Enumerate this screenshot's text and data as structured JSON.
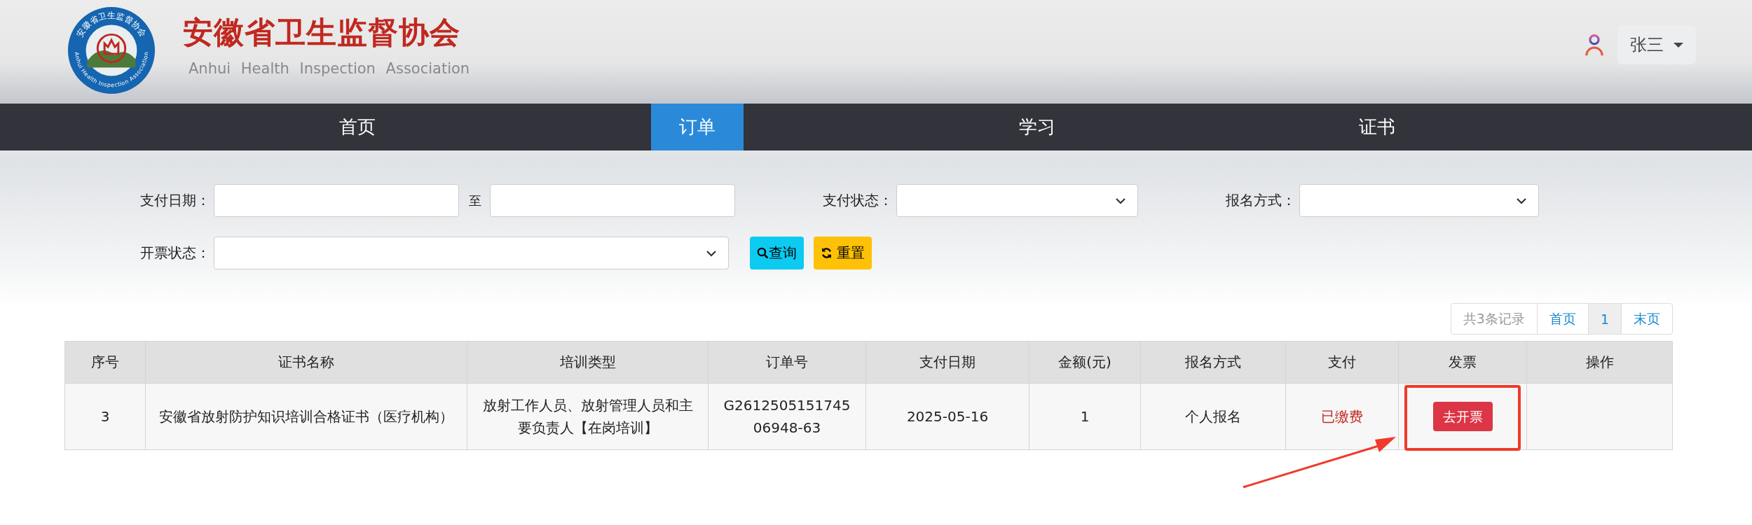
{
  "header": {
    "logo": {
      "ring_top": "安徽省卫生监督协会",
      "ring_bottom": "Anhui Health Inspection Association"
    },
    "title": "安徽省卫生监督协会",
    "subtitle": "Anhui Health Inspection Association",
    "user": "张三"
  },
  "nav": [
    {
      "label": "首页",
      "selected": false
    },
    {
      "label": "订单",
      "selected": true
    },
    {
      "label": "学习",
      "selected": false
    },
    {
      "label": "证书",
      "selected": false
    }
  ],
  "filters": {
    "pay_date_label": "支付日期：",
    "range_separator": "至",
    "pay_status_label": "支付状态：",
    "signup_label": "报名方式：",
    "invoice_status_label": "开票状态："
  },
  "buttons": [
    {
      "kind": "search",
      "label": "查询"
    },
    {
      "kind": "reset",
      "label": "重置"
    }
  ],
  "pagination": {
    "total": "共3条记录",
    "first": "首页",
    "pages": [
      {
        "label": "1",
        "selected": true
      }
    ],
    "last": "末页"
  },
  "table": {
    "columns": [
      "序号",
      "证书名称",
      "培训类型",
      "订单号",
      "支付日期",
      "金额(元)",
      "报名方式",
      "支付",
      "发票",
      "操作"
    ],
    "rows": [
      {
        "index": "3",
        "certificate": "安徽省放射防护知识培训合格证书（医疗机构）",
        "training_type": "放射工作人员、放射管理人员和主要负责人【在岗培训】",
        "order_no": "G261250515174506948-63",
        "pay_date": "2025-05-16",
        "amount": "1",
        "signup_method": "个人报名",
        "payment": {
          "label": "已缴费",
          "paid": true
        },
        "invoice_action": "去开票",
        "highlighted": true
      }
    ]
  }
}
